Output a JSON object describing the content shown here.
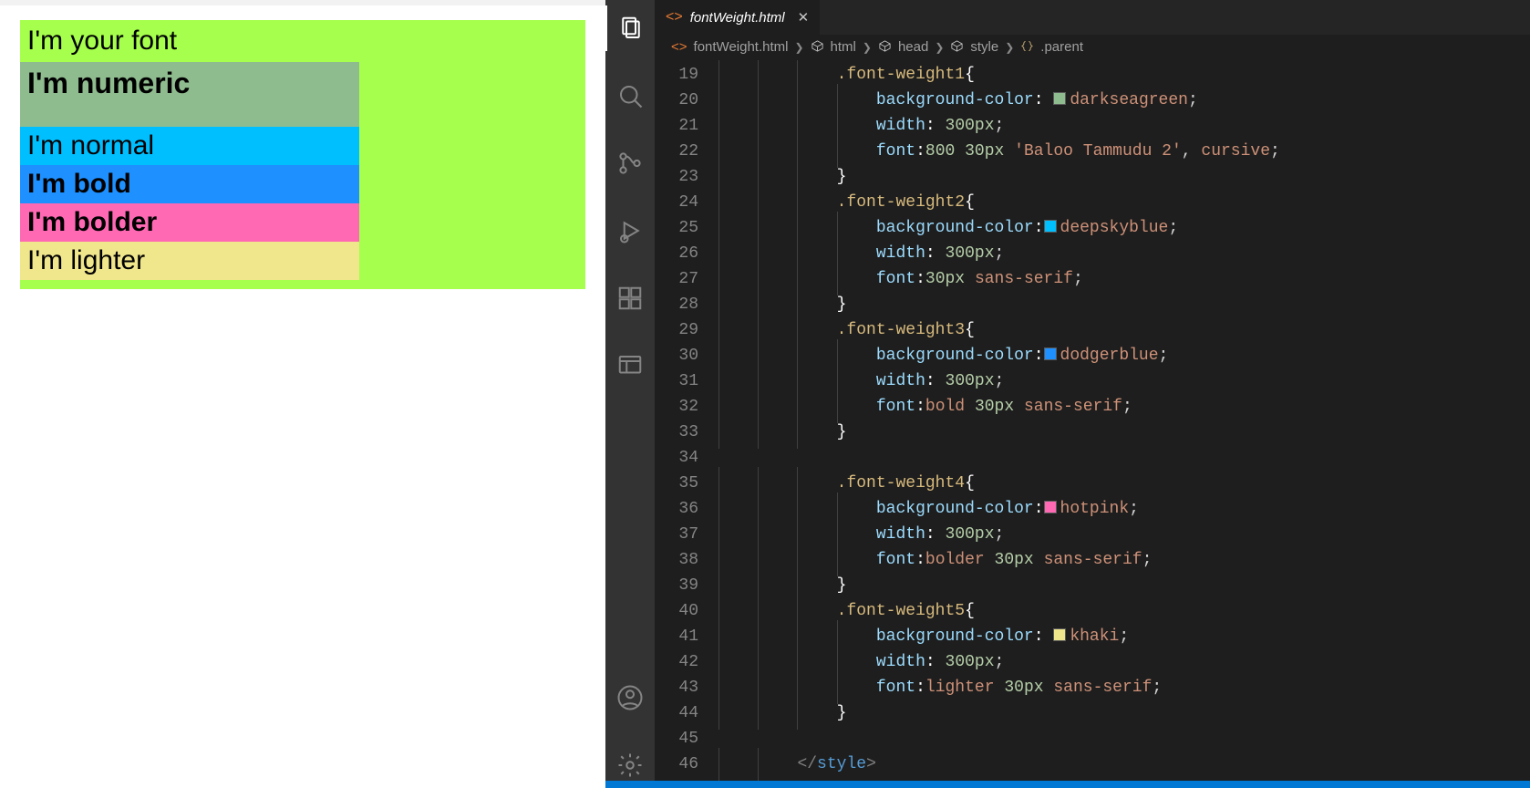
{
  "preview": {
    "parent_title": "I'm your font",
    "rows": {
      "numeric": "I'm numeric",
      "normal": "I'm normal",
      "bold": "I'm bold",
      "bolder": "I'm bolder",
      "lighter": "I'm lighter"
    },
    "colors": {
      "parent_bg": "#a6ff4d",
      "fw1_bg": "#8fbc8f",
      "fw2_bg": "#00bfff",
      "fw3_bg": "#1e90ff",
      "fw4_bg": "#ff69b4",
      "fw5_bg": "#f0e68c"
    }
  },
  "vscode": {
    "tab": {
      "filename": "fontWeight.html"
    },
    "breadcrumbs": {
      "file": "fontWeight.html",
      "html": "html",
      "head": "head",
      "style": "style",
      "parent": ".parent"
    },
    "line_start": 19,
    "line_end": 46,
    "code": [
      {
        "n": 19,
        "ind": 3,
        "t": [
          {
            "c": "selector",
            "s": ".font-weight1"
          },
          {
            "c": "brace",
            "s": "{"
          }
        ]
      },
      {
        "n": 20,
        "ind": 4,
        "t": [
          {
            "c": "prop",
            "s": "background-color"
          },
          {
            "c": "colon",
            "s": ":"
          },
          {
            "c": "",
            "s": " "
          },
          {
            "swatch": "darkseagreen"
          },
          {
            "c": "val",
            "s": "darkseagreen"
          },
          {
            "c": "punct",
            "s": ";"
          }
        ]
      },
      {
        "n": 21,
        "ind": 4,
        "t": [
          {
            "c": "prop",
            "s": "width"
          },
          {
            "c": "colon",
            "s": ":"
          },
          {
            "c": "",
            "s": " "
          },
          {
            "c": "num",
            "s": "300px"
          },
          {
            "c": "punct",
            "s": ";"
          }
        ]
      },
      {
        "n": 22,
        "ind": 4,
        "t": [
          {
            "c": "prop",
            "s": "font"
          },
          {
            "c": "colon",
            "s": ":"
          },
          {
            "c": "num",
            "s": "800"
          },
          {
            "c": "",
            "s": " "
          },
          {
            "c": "num",
            "s": "30px"
          },
          {
            "c": "",
            "s": " "
          },
          {
            "c": "val",
            "s": "'Baloo Tammudu 2'"
          },
          {
            "c": "punct",
            "s": ", "
          },
          {
            "c": "val",
            "s": "cursive"
          },
          {
            "c": "punct",
            "s": ";"
          }
        ]
      },
      {
        "n": 23,
        "ind": 3,
        "t": [
          {
            "c": "brace",
            "s": "}"
          }
        ]
      },
      {
        "n": 24,
        "ind": 3,
        "t": [
          {
            "c": "selector",
            "s": ".font-weight2"
          },
          {
            "c": "brace",
            "s": "{"
          }
        ]
      },
      {
        "n": 25,
        "ind": 4,
        "t": [
          {
            "c": "prop",
            "s": "background-color"
          },
          {
            "c": "colon",
            "s": ":"
          },
          {
            "swatch": "deepskyblue"
          },
          {
            "c": "val",
            "s": "deepskyblue"
          },
          {
            "c": "punct",
            "s": ";"
          }
        ]
      },
      {
        "n": 26,
        "ind": 4,
        "t": [
          {
            "c": "prop",
            "s": "width"
          },
          {
            "c": "colon",
            "s": ":"
          },
          {
            "c": "",
            "s": " "
          },
          {
            "c": "num",
            "s": "300px"
          },
          {
            "c": "punct",
            "s": ";"
          }
        ]
      },
      {
        "n": 27,
        "ind": 4,
        "t": [
          {
            "c": "prop",
            "s": "font"
          },
          {
            "c": "colon",
            "s": ":"
          },
          {
            "c": "num",
            "s": "30px"
          },
          {
            "c": "",
            "s": " "
          },
          {
            "c": "val",
            "s": "sans-serif"
          },
          {
            "c": "punct",
            "s": ";"
          }
        ]
      },
      {
        "n": 28,
        "ind": 3,
        "t": [
          {
            "c": "brace",
            "s": "}"
          }
        ]
      },
      {
        "n": 29,
        "ind": 3,
        "t": [
          {
            "c": "selector",
            "s": ".font-weight3"
          },
          {
            "c": "brace",
            "s": "{"
          }
        ]
      },
      {
        "n": 30,
        "ind": 4,
        "t": [
          {
            "c": "prop",
            "s": "background-color"
          },
          {
            "c": "colon",
            "s": ":"
          },
          {
            "swatch": "dodgerblue"
          },
          {
            "c": "val",
            "s": "dodgerblue"
          },
          {
            "c": "punct",
            "s": ";"
          }
        ]
      },
      {
        "n": 31,
        "ind": 4,
        "t": [
          {
            "c": "prop",
            "s": "width"
          },
          {
            "c": "colon",
            "s": ":"
          },
          {
            "c": "",
            "s": " "
          },
          {
            "c": "num",
            "s": "300px"
          },
          {
            "c": "punct",
            "s": ";"
          }
        ]
      },
      {
        "n": 32,
        "ind": 4,
        "t": [
          {
            "c": "prop",
            "s": "font"
          },
          {
            "c": "colon",
            "s": ":"
          },
          {
            "c": "kw",
            "s": "bold"
          },
          {
            "c": "",
            "s": " "
          },
          {
            "c": "num",
            "s": "30px"
          },
          {
            "c": "",
            "s": " "
          },
          {
            "c": "val",
            "s": "sans-serif"
          },
          {
            "c": "punct",
            "s": ";"
          }
        ]
      },
      {
        "n": 33,
        "ind": 3,
        "t": [
          {
            "c": "brace",
            "s": "}"
          }
        ]
      },
      {
        "n": 34,
        "ind": 0,
        "t": []
      },
      {
        "n": 35,
        "ind": 3,
        "t": [
          {
            "c": "selector",
            "s": ".font-weight4"
          },
          {
            "c": "brace",
            "s": "{"
          }
        ]
      },
      {
        "n": 36,
        "ind": 4,
        "t": [
          {
            "c": "prop",
            "s": "background-color"
          },
          {
            "c": "colon",
            "s": ":"
          },
          {
            "swatch": "hotpink"
          },
          {
            "c": "val",
            "s": "hotpink"
          },
          {
            "c": "punct",
            "s": ";"
          }
        ]
      },
      {
        "n": 37,
        "ind": 4,
        "t": [
          {
            "c": "prop",
            "s": "width"
          },
          {
            "c": "colon",
            "s": ":"
          },
          {
            "c": "",
            "s": " "
          },
          {
            "c": "num",
            "s": "300px"
          },
          {
            "c": "punct",
            "s": ";"
          }
        ]
      },
      {
        "n": 38,
        "ind": 4,
        "t": [
          {
            "c": "prop",
            "s": "font"
          },
          {
            "c": "colon",
            "s": ":"
          },
          {
            "c": "kw",
            "s": "bolder"
          },
          {
            "c": "",
            "s": " "
          },
          {
            "c": "num",
            "s": "30px"
          },
          {
            "c": "",
            "s": " "
          },
          {
            "c": "val",
            "s": "sans-serif"
          },
          {
            "c": "punct",
            "s": ";"
          }
        ]
      },
      {
        "n": 39,
        "ind": 3,
        "t": [
          {
            "c": "brace",
            "s": "}"
          }
        ]
      },
      {
        "n": 40,
        "ind": 3,
        "t": [
          {
            "c": "selector",
            "s": ".font-weight5"
          },
          {
            "c": "brace",
            "s": "{"
          }
        ]
      },
      {
        "n": 41,
        "ind": 4,
        "t": [
          {
            "c": "prop",
            "s": "background-color"
          },
          {
            "c": "colon",
            "s": ":"
          },
          {
            "c": "",
            "s": " "
          },
          {
            "swatch": "khaki"
          },
          {
            "c": "val",
            "s": "khaki"
          },
          {
            "c": "punct",
            "s": ";"
          }
        ]
      },
      {
        "n": 42,
        "ind": 4,
        "t": [
          {
            "c": "prop",
            "s": "width"
          },
          {
            "c": "colon",
            "s": ":"
          },
          {
            "c": "",
            "s": " "
          },
          {
            "c": "num",
            "s": "300px"
          },
          {
            "c": "punct",
            "s": ";"
          }
        ]
      },
      {
        "n": 43,
        "ind": 4,
        "t": [
          {
            "c": "prop",
            "s": "font"
          },
          {
            "c": "colon",
            "s": ":"
          },
          {
            "c": "kw",
            "s": "lighter"
          },
          {
            "c": "",
            "s": " "
          },
          {
            "c": "num",
            "s": "30px"
          },
          {
            "c": "",
            "s": " "
          },
          {
            "c": "val",
            "s": "sans-serif"
          },
          {
            "c": "punct",
            "s": ";"
          }
        ]
      },
      {
        "n": 44,
        "ind": 3,
        "t": [
          {
            "c": "brace",
            "s": "}"
          }
        ]
      },
      {
        "n": 45,
        "ind": 0,
        "t": []
      },
      {
        "n": 46,
        "ind": 2,
        "t": [
          {
            "c": "tag",
            "s": "</"
          },
          {
            "c": "tagname",
            "s": "style"
          },
          {
            "c": "tag",
            "s": ">"
          }
        ]
      }
    ]
  }
}
